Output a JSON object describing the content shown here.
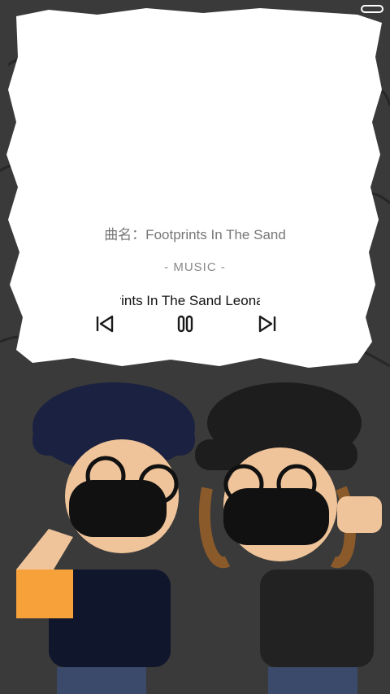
{
  "player": {
    "song_line": "曲名：Footprints In The Sand",
    "music_label": "- MUSIC -",
    "scrolling_title": "Footprints In The Sand   Leona Lewis"
  },
  "controls": {
    "previous_icon": "previous-track-icon",
    "pause_icon": "pause-icon",
    "next_icon": "next-track-icon"
  },
  "colors": {
    "paper": "#ffffff",
    "icon": "#1a1a1a",
    "song_text": "#777777"
  }
}
